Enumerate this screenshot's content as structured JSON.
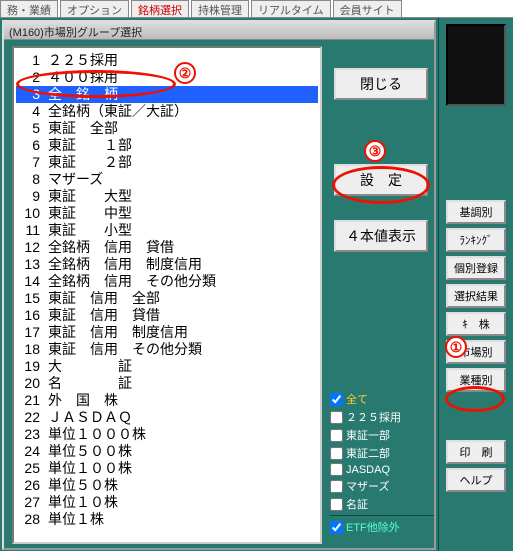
{
  "top_tabs": [
    "務・業績",
    "オプション",
    "銘柄選択",
    "持株管理",
    "リアルタイム",
    "会員サイト"
  ],
  "dialog_title": "(M160)市場別グループ選択",
  "list": [
    {
      "idx": 1,
      "label": "２２５採用"
    },
    {
      "idx": 2,
      "label": "４００採用"
    },
    {
      "idx": 3,
      "label": "全　銘　柄",
      "selected": true
    },
    {
      "idx": 4,
      "label": "全銘柄（東証／大証）"
    },
    {
      "idx": 5,
      "label": "東証　全部"
    },
    {
      "idx": 6,
      "label": "東証　　１部"
    },
    {
      "idx": 7,
      "label": "東証　　２部"
    },
    {
      "idx": 8,
      "label": "マザーズ"
    },
    {
      "idx": 9,
      "label": "東証　　大型"
    },
    {
      "idx": 10,
      "label": "東証　　中型"
    },
    {
      "idx": 11,
      "label": "東証　　小型"
    },
    {
      "idx": 12,
      "label": "全銘柄　信用　貸借"
    },
    {
      "idx": 13,
      "label": "全銘柄　信用　制度信用"
    },
    {
      "idx": 14,
      "label": "全銘柄　信用　その他分類"
    },
    {
      "idx": 15,
      "label": "東証　信用　全部"
    },
    {
      "idx": 16,
      "label": "東証　信用　貸借"
    },
    {
      "idx": 17,
      "label": "東証　信用　制度信用"
    },
    {
      "idx": 18,
      "label": "東証　信用　その他分類"
    },
    {
      "idx": 19,
      "label": "大　　　　証"
    },
    {
      "idx": 20,
      "label": "名　　　　証"
    },
    {
      "idx": 21,
      "label": "外　国　株"
    },
    {
      "idx": 22,
      "label": "ＪＡＳＤＡＱ"
    },
    {
      "idx": 23,
      "label": "単位１０００株"
    },
    {
      "idx": 24,
      "label": "単位５００株"
    },
    {
      "idx": 25,
      "label": "単位１００株"
    },
    {
      "idx": 26,
      "label": "単位５０株"
    },
    {
      "idx": 27,
      "label": "単位１０株"
    },
    {
      "idx": 28,
      "label": "単位１株"
    }
  ],
  "buttons": {
    "close": "閉じる",
    "settei": "設　定",
    "yonhon": "４本値表示"
  },
  "checks": [
    {
      "label": "全て",
      "checked": true,
      "cls": "chk-yellow"
    },
    {
      "label": "２２５採用",
      "checked": false,
      "cls": "chk-white"
    },
    {
      "label": "東証一部",
      "checked": false,
      "cls": "chk-white"
    },
    {
      "label": "東証二部",
      "checked": false,
      "cls": "chk-white"
    },
    {
      "label": "JASDAQ",
      "checked": false,
      "cls": "chk-white"
    },
    {
      "label": "マザーズ",
      "checked": false,
      "cls": "chk-white"
    },
    {
      "label": "名証",
      "checked": false,
      "cls": "chk-white"
    }
  ],
  "etf_check": {
    "label": "ETF他除外",
    "checked": true
  },
  "side_buttons": {
    "kijun": "基調別",
    "ranking": "ﾗﾝｷﾝｸﾞ",
    "kobetsu": "個別登録",
    "sentaku": "選択結果",
    "kabu": "ｷ　株",
    "shijo": "市場別",
    "gyoshu": "業種別",
    "insatsu": "印　刷",
    "help": "ヘルプ"
  },
  "annotations": {
    "n1": "①",
    "n2": "②",
    "n3": "③"
  }
}
